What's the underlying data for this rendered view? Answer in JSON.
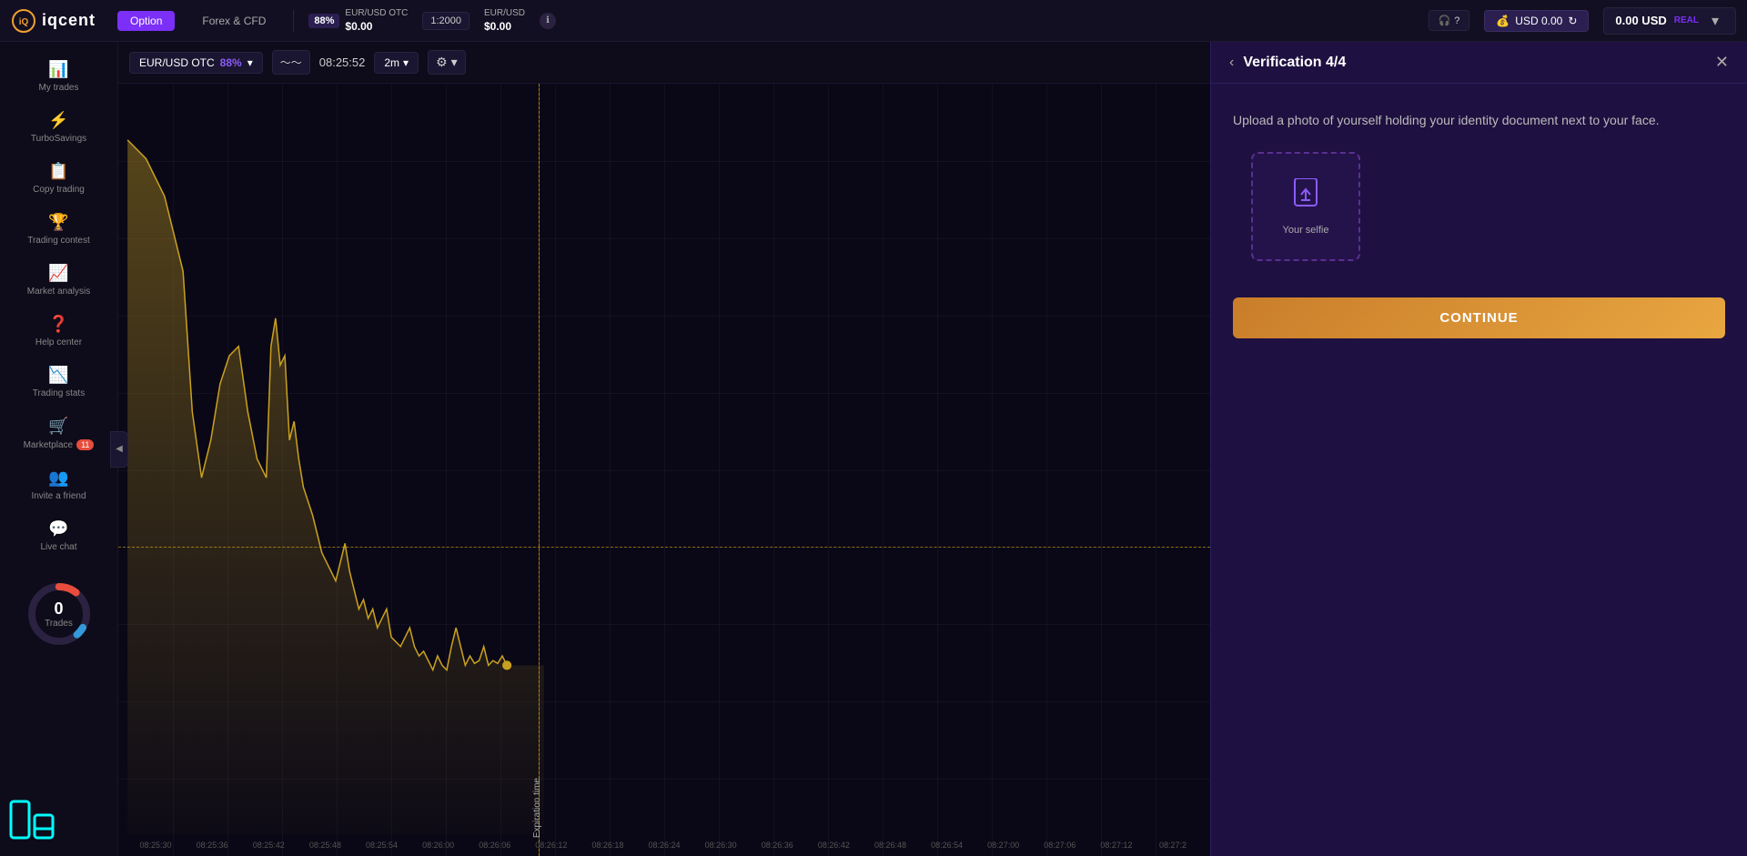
{
  "logo": {
    "text": "iqcent"
  },
  "topnav": {
    "option_tab": "Option",
    "forex_tab": "Forex & CFD",
    "pair_label": "EUR/USD OTC",
    "pair_pct": "88%",
    "pair_price": "$0.00",
    "leverage_label": "1:2000",
    "pair2_label": "EUR/USD",
    "pair2_price": "$0.00",
    "support_label": "?",
    "usd_label": "USD 0.00",
    "balance_label": "0.00 USD",
    "real_label": "REAL",
    "dropdown_icon": "▾"
  },
  "sidebar": {
    "items": [
      {
        "id": "my-trades",
        "icon": "📊",
        "label": "My trades"
      },
      {
        "id": "turbo-savings",
        "icon": "⚡",
        "label": "TurboSavings"
      },
      {
        "id": "copy-trading",
        "icon": "📋",
        "label": "Copy trading"
      },
      {
        "id": "trading-contest",
        "icon": "🏆",
        "label": "Trading contest"
      },
      {
        "id": "market-analysis",
        "icon": "📈",
        "label": "Market analysis"
      },
      {
        "id": "help-center",
        "icon": "❓",
        "label": "Help center"
      },
      {
        "id": "trading-stats",
        "icon": "📉",
        "label": "Trading stats"
      },
      {
        "id": "marketplace",
        "icon": "🛒",
        "label": "Marketplace",
        "badge": "11"
      },
      {
        "id": "invite-friend",
        "icon": "👥",
        "label": "Invite a friend"
      },
      {
        "id": "live-chat",
        "icon": "💬",
        "label": "Live chat"
      }
    ],
    "trades_count": "0",
    "trades_label": "Trades"
  },
  "chart": {
    "pair_label": "EUR/USD OTC",
    "pair_pct": "88%",
    "time_display": "08:25:52",
    "interval": "2m",
    "time_ticks": [
      "08:25:30",
      "08:25:36",
      "08:25:42",
      "08:25:48",
      "08:25:54",
      "08:26:00",
      "08:26:06",
      "08:26:12",
      "08:26:18",
      "08:26:24",
      "08:26:30",
      "08:26:36",
      "08:26:42",
      "08:26:48",
      "08:26:54",
      "08:27:00",
      "08:27:06",
      "08:27:12",
      "08:27:2"
    ],
    "expiration_label": "Expiration time"
  },
  "verification": {
    "title": "Verification 4/4",
    "description": "Upload a photo of yourself holding your identity document next to your face.",
    "selfie_label": "Your selfie",
    "continue_label": "CONTINUE",
    "close_icon": "✕",
    "back_icon": "‹"
  }
}
